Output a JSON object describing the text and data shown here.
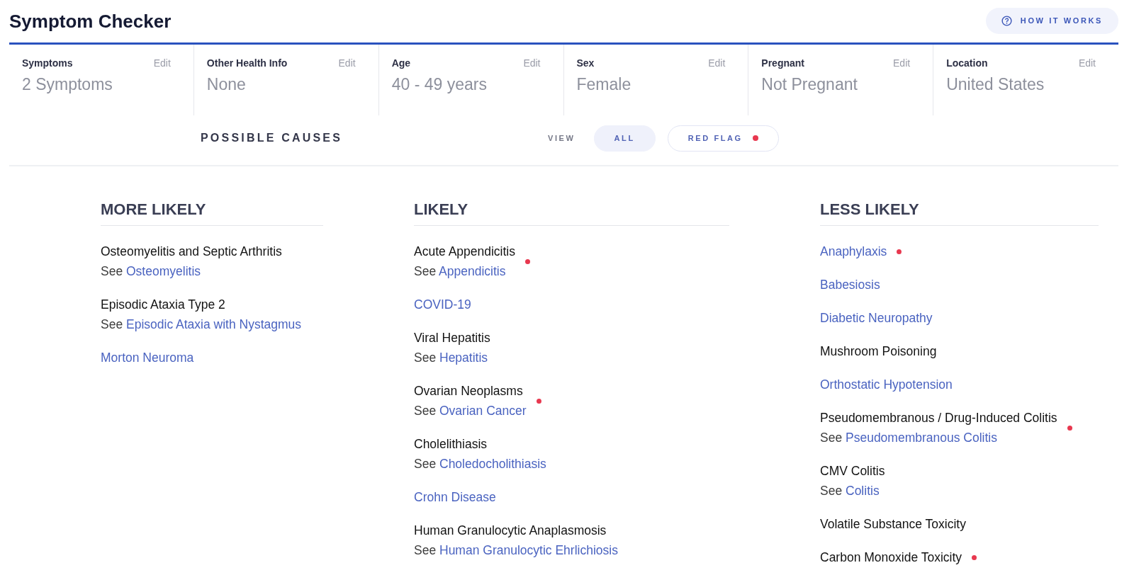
{
  "header": {
    "title": "Symptom Checker",
    "help_button": "HOW IT WORKS"
  },
  "info": [
    {
      "label": "Symptoms",
      "edit": "Edit",
      "value": "2 Symptoms"
    },
    {
      "label": "Other Health Info",
      "edit": "Edit",
      "value": "None"
    },
    {
      "label": "Age",
      "edit": "Edit",
      "value": "40 - 49 years"
    },
    {
      "label": "Sex",
      "edit": "Edit",
      "value": "Female"
    },
    {
      "label": "Pregnant",
      "edit": "Edit",
      "value": "Not Pregnant"
    },
    {
      "label": "Location",
      "edit": "Edit",
      "value": "United States"
    }
  ],
  "filter": {
    "title": "POSSIBLE CAUSES",
    "view_label": "VIEW",
    "options": [
      {
        "label": "ALL",
        "selected": true,
        "red_flag": false
      },
      {
        "label": "RED FLAG",
        "selected": false,
        "red_flag": true
      }
    ]
  },
  "columns": [
    {
      "heading": "MORE LIKELY",
      "items": [
        {
          "name": "Osteomyelitis and Septic Arthritis",
          "is_link": false,
          "see_prefix": "See",
          "see_link": "Osteomyelitis",
          "red_flag": false
        },
        {
          "name": "Episodic Ataxia Type 2",
          "is_link": false,
          "see_prefix": "See",
          "see_link": "Episodic Ataxia with Nystagmus",
          "red_flag": false
        },
        {
          "name": "Morton Neuroma",
          "is_link": true,
          "red_flag": false
        }
      ]
    },
    {
      "heading": "LIKELY",
      "items": [
        {
          "name": "Acute Appendicitis",
          "is_link": false,
          "see_prefix": "See",
          "see_link": "Appendicitis",
          "red_flag": true
        },
        {
          "name": "COVID-19",
          "is_link": true,
          "red_flag": false
        },
        {
          "name": "Viral Hepatitis",
          "is_link": false,
          "see_prefix": "See",
          "see_link": "Hepatitis",
          "red_flag": false
        },
        {
          "name": "Ovarian Neoplasms",
          "is_link": false,
          "see_prefix": "See",
          "see_link": "Ovarian Cancer",
          "red_flag": true
        },
        {
          "name": "Cholelithiasis",
          "is_link": false,
          "see_prefix": "See",
          "see_link": "Choledocholithiasis",
          "red_flag": false
        },
        {
          "name": "Crohn Disease",
          "is_link": true,
          "red_flag": false
        },
        {
          "name": "Human Granulocytic Anaplasmosis",
          "is_link": false,
          "see_prefix": "See",
          "see_link": "Human Granulocytic Ehrlichiosis",
          "red_flag": false
        }
      ]
    },
    {
      "heading": "LESS LIKELY",
      "items": [
        {
          "name": "Anaphylaxis",
          "is_link": true,
          "red_flag": true
        },
        {
          "name": "Babesiosis",
          "is_link": true,
          "red_flag": false
        },
        {
          "name": "Diabetic Neuropathy",
          "is_link": true,
          "red_flag": false
        },
        {
          "name": "Mushroom Poisoning",
          "is_link": false,
          "red_flag": false
        },
        {
          "name": "Orthostatic Hypotension",
          "is_link": true,
          "red_flag": false
        },
        {
          "name": "Pseudomembranous / Drug-Induced Colitis",
          "is_link": false,
          "see_prefix": "See",
          "see_link": "Pseudomembranous Colitis",
          "red_flag": true
        },
        {
          "name": "CMV Colitis",
          "is_link": false,
          "see_prefix": "See",
          "see_link": "Colitis",
          "red_flag": false
        },
        {
          "name": "Volatile Substance Toxicity",
          "is_link": false,
          "red_flag": false
        },
        {
          "name": "Carbon Monoxide Toxicity",
          "is_link": false,
          "red_flag": true
        }
      ]
    }
  ]
}
